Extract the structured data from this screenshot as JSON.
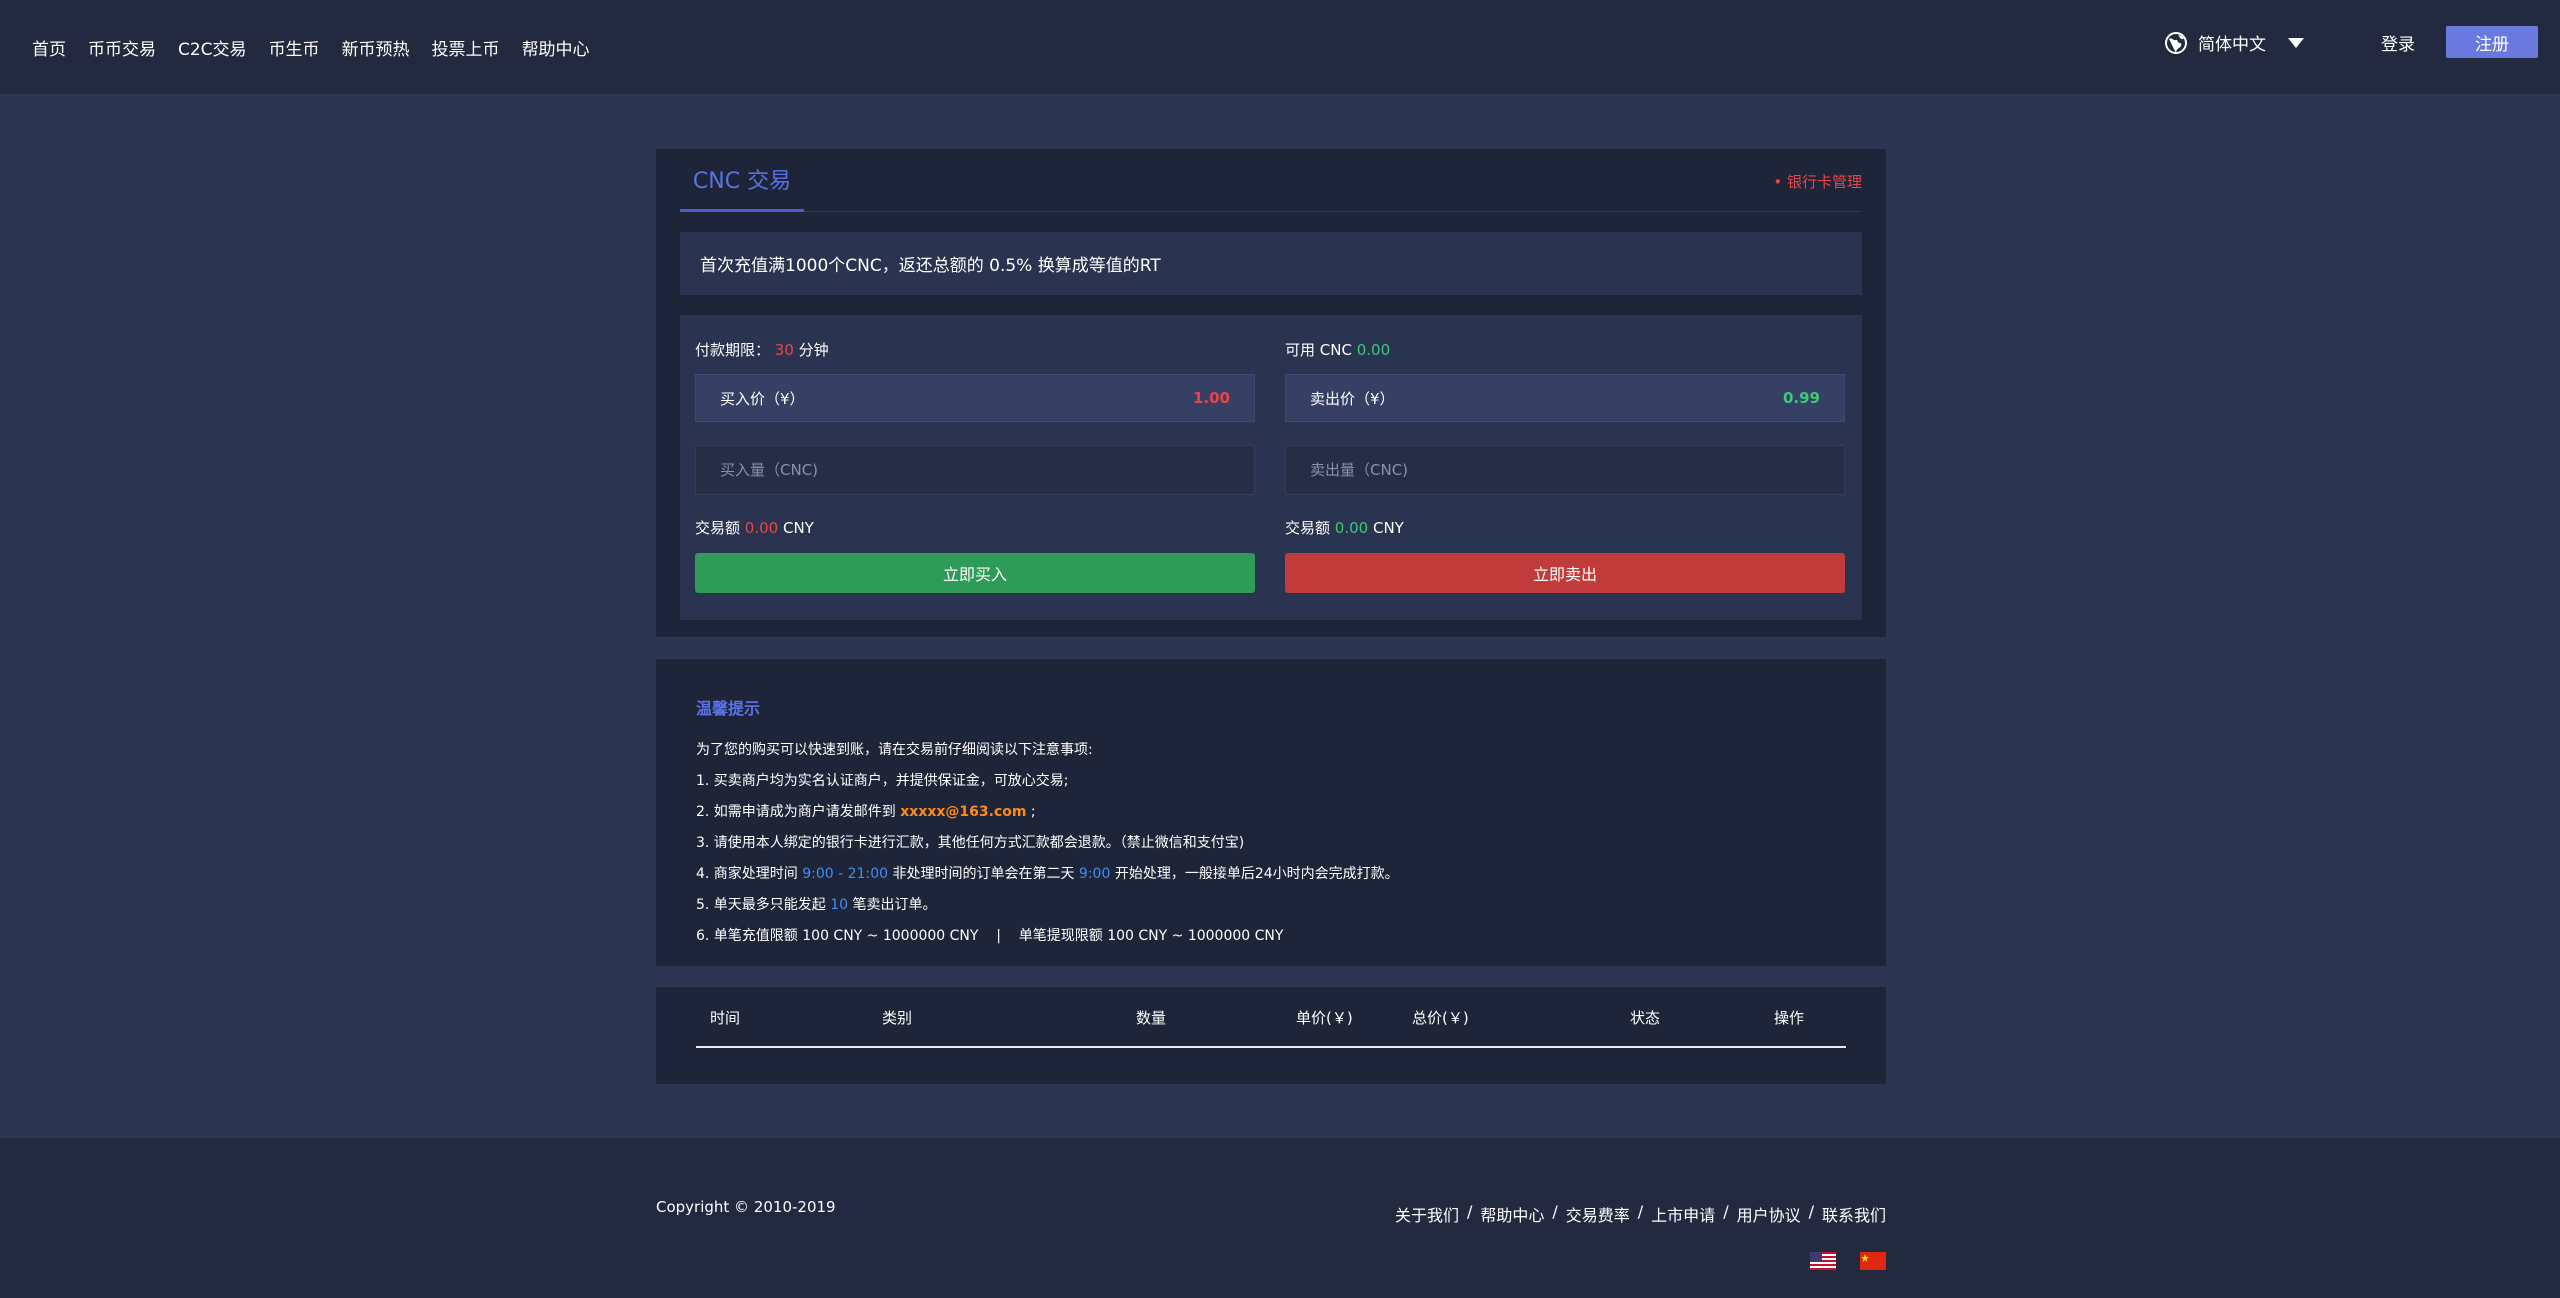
{
  "header": {
    "nav": [
      "首页",
      "币币交易",
      "C2C交易",
      "币生币",
      "新币预热",
      "投票上币",
      "帮助中心"
    ],
    "language": "简体中文",
    "login": "登录",
    "register": "注册"
  },
  "trade": {
    "tab": "CNC 交易",
    "bank_link": "• 银行卡管理",
    "notice": "首次充值满1000个CNC，返还总额的 0.5% 换算成等值的RT",
    "buy": {
      "limit_label": "付款期限：",
      "limit_value": "30",
      "limit_unit": "分钟",
      "price_label": "买入价（¥）",
      "price": "1.00",
      "amount_placeholder": "买入量（CNC)",
      "total_label": "交易额",
      "total_value": "0.00",
      "total_unit": "CNY",
      "button": "立即买入"
    },
    "sell": {
      "available_label": "可用 CNC",
      "available_value": "0.00",
      "price_label": "卖出价（¥）",
      "price": "0.99",
      "amount_placeholder": "卖出量（CNC)",
      "total_label": "交易额",
      "total_value": "0.00",
      "total_unit": "CNY",
      "button": "立即卖出"
    }
  },
  "tips": {
    "title": "温馨提示",
    "intro": "为了您的购买可以快速到账，请在交易前仔细阅读以下注意事项:",
    "item1": "1. 买卖商户均为实名认证商户，并提供保证金，可放心交易;",
    "item2_pre": "2. 如需申请成为商户请发邮件到",
    "item2_email": "xxxxx@163.com",
    "item2_post": ";",
    "item3": "3. 请使用本人绑定的银行卡进行汇款，其他任何方式汇款都会退款。（禁止微信和支付宝)",
    "item4_pre": "4. 商家处理时间",
    "item4_time": "9:00 - 21:00",
    "item4_mid": "非处理时间的订单会在第二天",
    "item4_time2": "9:00",
    "item4_post": "开始处理，一般接单后24小时内会完成打款。",
    "item5_pre": "5. 单天最多只能发起",
    "item5_count": "10",
    "item5_post": "笔卖出订单。",
    "item6": "6. 单笔充值限额 100 CNY ~ 1000000 CNY    |    单笔提现限额 100 CNY ~ 1000000 CNY"
  },
  "table": {
    "columns": [
      "时间",
      "类别",
      "数量",
      "单价(￥)",
      "总价(￥)",
      "状态",
      "操作"
    ]
  },
  "footer": {
    "copyright": "Copyright © 2010-2019",
    "links": [
      "关于我们",
      "帮助中心",
      "交易费率",
      "上市申请",
      "用户协议",
      "联系我们"
    ]
  }
}
